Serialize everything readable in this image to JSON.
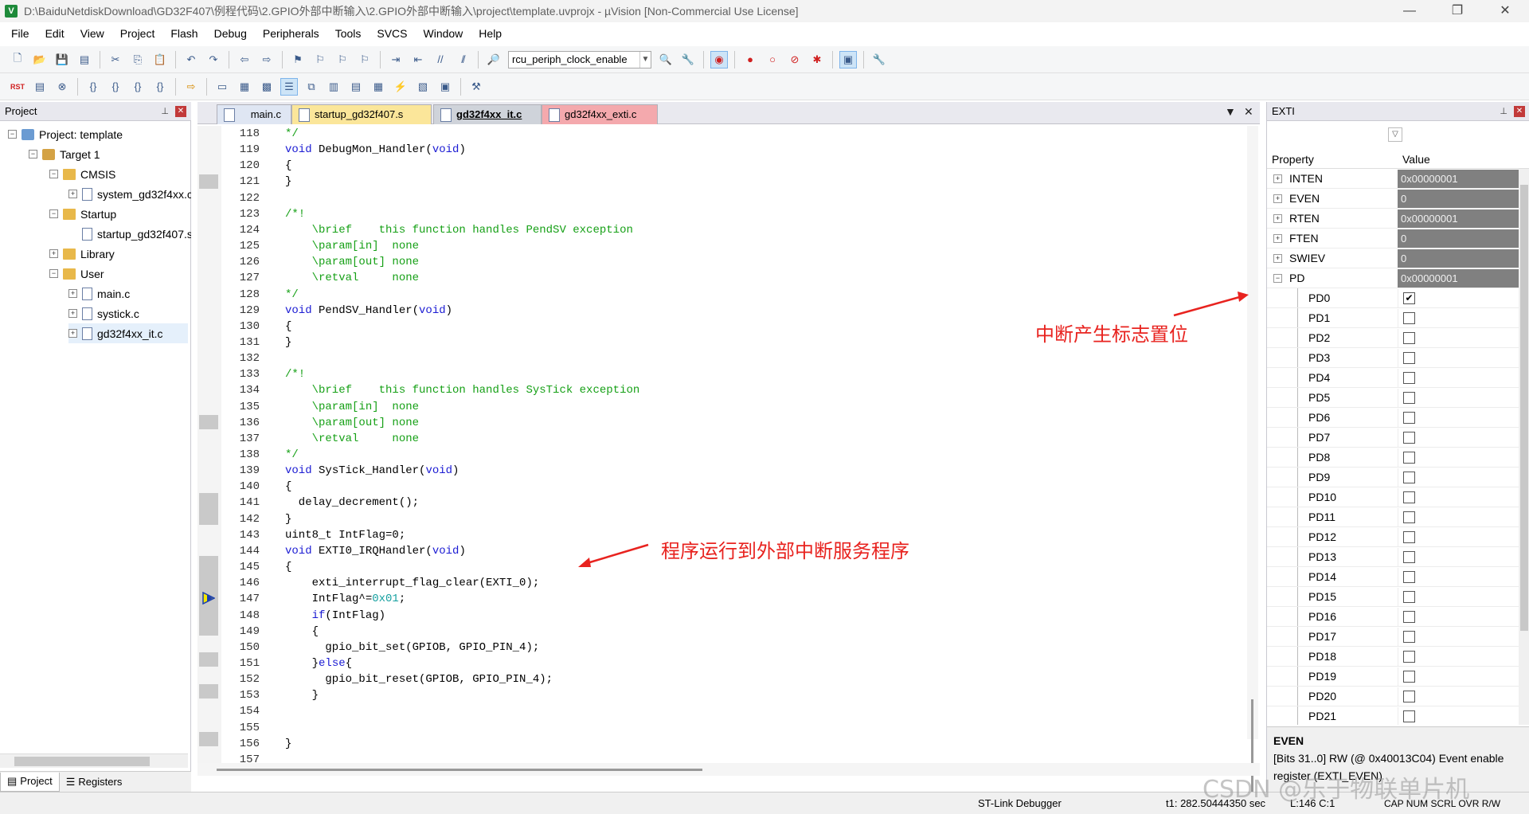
{
  "window": {
    "title": "D:\\BaiduNetdiskDownload\\GD32F407\\例程代码\\2.GPIO外部中断输入\\2.GPIO外部中断输入\\project\\template.uvprojx - µVision  [Non-Commercial Use License]"
  },
  "menu": [
    "File",
    "Edit",
    "View",
    "Project",
    "Flash",
    "Debug",
    "Peripherals",
    "Tools",
    "SVCS",
    "Window",
    "Help"
  ],
  "toolbar": {
    "combo_value": "rcu_periph_clock_enable"
  },
  "project_panel": {
    "title": "Project",
    "tree": [
      {
        "label": "Project: template",
        "toggle": "−"
      },
      {
        "label": "Target 1",
        "toggle": "−"
      },
      {
        "label": "CMSIS",
        "toggle": "−"
      },
      {
        "label": "system_gd32f4xx.c",
        "toggle": "+"
      },
      {
        "label": "Startup",
        "toggle": "−"
      },
      {
        "label": "startup_gd32f407.s",
        "toggle": ""
      },
      {
        "label": "Library",
        "toggle": "+"
      },
      {
        "label": "User",
        "toggle": "−"
      },
      {
        "label": "main.c",
        "toggle": "+"
      },
      {
        "label": "systick.c",
        "toggle": "+"
      },
      {
        "label": "gd32f4xx_it.c",
        "toggle": "+"
      }
    ],
    "tabs": [
      "Project",
      "Registers"
    ]
  },
  "editor": {
    "tabs": [
      "main.c",
      "startup_gd32f407.s",
      "gd32f4xx_it.c",
      "gd32f4xx_exti.c"
    ],
    "active_tab": "gd32f4xx_it.c",
    "lines": [
      {
        "n": "118",
        "t": "*/"
      },
      {
        "n": "119",
        "t": "void DebugMon_Handler(void)"
      },
      {
        "n": "120",
        "t": "{"
      },
      {
        "n": "121",
        "t": "}"
      },
      {
        "n": "122",
        "t": ""
      },
      {
        "n": "123",
        "t": "/*!"
      },
      {
        "n": "124",
        "t": "    \\brief    this function handles PendSV exception"
      },
      {
        "n": "125",
        "t": "    \\param[in]  none"
      },
      {
        "n": "126",
        "t": "    \\param[out] none"
      },
      {
        "n": "127",
        "t": "    \\retval     none"
      },
      {
        "n": "128",
        "t": "*/"
      },
      {
        "n": "129",
        "t": "void PendSV_Handler(void)"
      },
      {
        "n": "130",
        "t": "{"
      },
      {
        "n": "131",
        "t": "}"
      },
      {
        "n": "132",
        "t": ""
      },
      {
        "n": "133",
        "t": "/*!"
      },
      {
        "n": "134",
        "t": "    \\brief    this function handles SysTick exception"
      },
      {
        "n": "135",
        "t": "    \\param[in]  none"
      },
      {
        "n": "136",
        "t": "    \\param[out] none"
      },
      {
        "n": "137",
        "t": "    \\retval     none"
      },
      {
        "n": "138",
        "t": "*/"
      },
      {
        "n": "139",
        "t": "void SysTick_Handler(void)"
      },
      {
        "n": "140",
        "t": "{"
      },
      {
        "n": "141",
        "t": "  delay_decrement();"
      },
      {
        "n": "142",
        "t": "}"
      },
      {
        "n": "143",
        "t": "uint8_t IntFlag=0;"
      },
      {
        "n": "144",
        "t": "void EXTI0_IRQHandler(void)"
      },
      {
        "n": "145",
        "t": "{"
      },
      {
        "n": "146",
        "t": "    exti_interrupt_flag_clear(EXTI_0);"
      },
      {
        "n": "147",
        "t": "    IntFlag^=0x01;"
      },
      {
        "n": "148",
        "t": "    if(IntFlag)"
      },
      {
        "n": "149",
        "t": "    {"
      },
      {
        "n": "150",
        "t": "      gpio_bit_set(GPIOB, GPIO_PIN_4);"
      },
      {
        "n": "151",
        "t": "    }else{"
      },
      {
        "n": "152",
        "t": "      gpio_bit_reset(GPIOB, GPIO_PIN_4);"
      },
      {
        "n": "153",
        "t": "    }"
      },
      {
        "n": "154",
        "t": ""
      },
      {
        "n": "155",
        "t": ""
      },
      {
        "n": "156",
        "t": "}"
      },
      {
        "n": "157",
        "t": ""
      }
    ]
  },
  "annotations": {
    "isr": "程序运行到外部中断服务程序",
    "flag": "中断产生标志置位"
  },
  "exti_panel": {
    "title": "EXTI",
    "col_property": "Property",
    "col_value": "Value",
    "registers": [
      {
        "name": "INTEN",
        "value": "0x00000001",
        "toggle": "+"
      },
      {
        "name": "EVEN",
        "value": "0",
        "toggle": "+"
      },
      {
        "name": "RTEN",
        "value": "0x00000001",
        "toggle": "+"
      },
      {
        "name": "FTEN",
        "value": "0",
        "toggle": "+"
      },
      {
        "name": "SWIEV",
        "value": "0",
        "toggle": "+"
      },
      {
        "name": "PD",
        "value": "0x00000001",
        "toggle": "−"
      }
    ],
    "bits": [
      {
        "name": "PD0",
        "checked": true
      },
      {
        "name": "PD1",
        "checked": false
      },
      {
        "name": "PD2",
        "checked": false
      },
      {
        "name": "PD3",
        "checked": false
      },
      {
        "name": "PD4",
        "checked": false
      },
      {
        "name": "PD5",
        "checked": false
      },
      {
        "name": "PD6",
        "checked": false
      },
      {
        "name": "PD7",
        "checked": false
      },
      {
        "name": "PD8",
        "checked": false
      },
      {
        "name": "PD9",
        "checked": false
      },
      {
        "name": "PD10",
        "checked": false
      },
      {
        "name": "PD11",
        "checked": false
      },
      {
        "name": "PD12",
        "checked": false
      },
      {
        "name": "PD13",
        "checked": false
      },
      {
        "name": "PD14",
        "checked": false
      },
      {
        "name": "PD15",
        "checked": false
      },
      {
        "name": "PD16",
        "checked": false
      },
      {
        "name": "PD17",
        "checked": false
      },
      {
        "name": "PD18",
        "checked": false
      },
      {
        "name": "PD19",
        "checked": false
      },
      {
        "name": "PD20",
        "checked": false
      },
      {
        "name": "PD21",
        "checked": false
      }
    ],
    "desc_title": "EVEN",
    "desc_text": "[Bits 31..0] RW (@ 0x40013C04) Event enable register (EXTI_EVEN)"
  },
  "statusbar": {
    "debugger": "ST-Link Debugger",
    "time": "t1: 282.50444350 sec",
    "position": "L:146 C:1",
    "flags": "CAP  NUM  SCRL  OVR  R/W"
  },
  "watermark": "CSDN @乐于物联单片机",
  "colors": {
    "keyword": "#1b1bd3",
    "comment": "#16a016",
    "annotation": "#e8231f",
    "reg_value_bg": "#808080"
  }
}
